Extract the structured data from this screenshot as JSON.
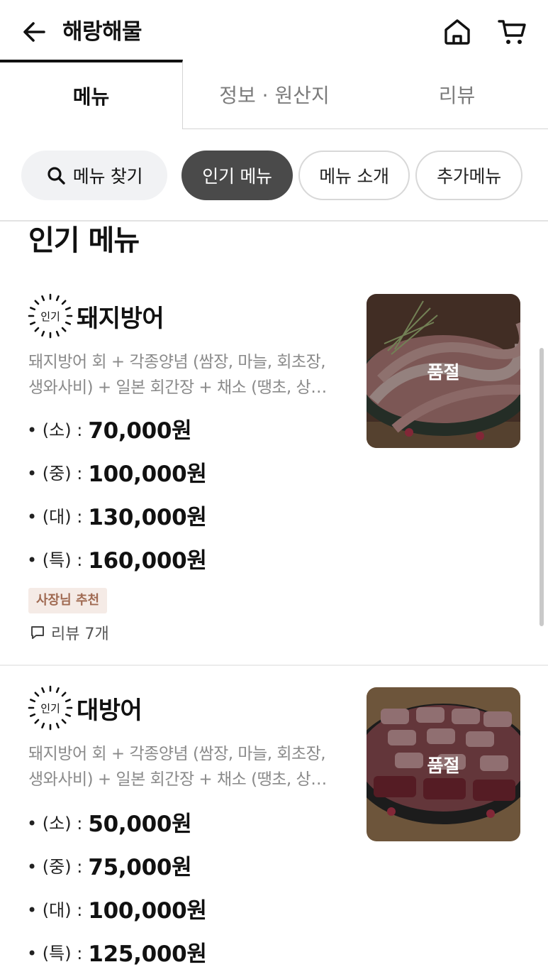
{
  "header": {
    "title": "해랑해물",
    "back_icon": "arrow-left-icon",
    "home_icon": "home-icon",
    "cart_icon": "cart-icon"
  },
  "tabs": [
    {
      "label": "메뉴",
      "active": true
    },
    {
      "label": "정보 · 원산지",
      "active": false
    },
    {
      "label": "리뷰",
      "active": false
    }
  ],
  "chips": {
    "search": "메뉴 찾기",
    "popular": "인기 메뉴",
    "intro": "메뉴 소개",
    "extra": "추가메뉴"
  },
  "section_title": "인기 메뉴",
  "popular_badge_text": "인기",
  "items": [
    {
      "name": "돼지방어",
      "desc_line1": "돼지방어 회 + 각종양념 (쌈장, 마늘, 회초장,",
      "desc_line2": "생와사비) + 일본 회간장 + 채소 (땡초, 상…",
      "prices": [
        {
          "label": "• (소) :",
          "value": "70,000원"
        },
        {
          "label": "• (중) :",
          "value": "100,000원"
        },
        {
          "label": "• (대) :",
          "value": "130,000원"
        },
        {
          "label": "• (특) :",
          "value": "160,000원"
        }
      ],
      "recommend_badge": "사장님 추천",
      "review": "리뷰 7개",
      "soldout": "품절"
    },
    {
      "name": "대방어",
      "desc_line1": "돼지방어 회 + 각종양념 (쌈장, 마늘, 회초장,",
      "desc_line2": "생와사비) + 일본 회간장 + 채소 (땡초, 상…",
      "prices": [
        {
          "label": "• (소) :",
          "value": "50,000원"
        },
        {
          "label": "• (중) :",
          "value": "75,000원"
        },
        {
          "label": "• (대) :",
          "value": "100,000원"
        },
        {
          "label": "• (특) :",
          "value": "125,000원"
        }
      ],
      "soldout": "품절"
    }
  ],
  "colors": {
    "active_chip": "#4a4a4a",
    "badge_bg": "#f5ebe6",
    "badge_text": "#a06a52"
  }
}
